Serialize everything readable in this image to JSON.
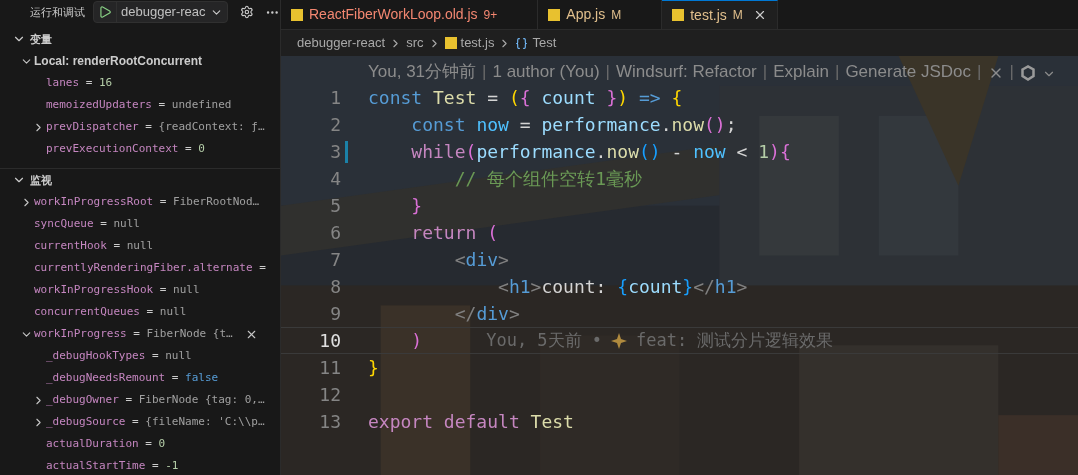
{
  "sidebar": {
    "title": "运行和调试",
    "config": "debugger-reac",
    "sections": [
      {
        "title": "变量",
        "expanded": true,
        "items": [
          {
            "name": "Local: renderRootConcurrent",
            "kind": "scope",
            "expanded": true,
            "children": [
              {
                "name": "lanes",
                "sep": "=",
                "value": "16",
                "kind": "number"
              },
              {
                "name": "memoizedUpdaters",
                "sep": "=",
                "value": "undefined",
                "kind": "plain"
              },
              {
                "name": "prevDispatcher",
                "sep": "=",
                "value": "{readContext: ƒ…",
                "kind": "plain",
                "expanded": false
              },
              {
                "name": "prevExecutionContext",
                "sep": "=",
                "value": "0",
                "kind": "number"
              }
            ]
          }
        ]
      },
      {
        "title": "监视",
        "expanded": true,
        "items": [
          {
            "name": "workInProgressRoot",
            "sep": "=",
            "value": "FiberRootNod…",
            "kind": "plain",
            "expanded": false
          },
          {
            "name": "syncQueue",
            "sep": "=",
            "value": "null",
            "kind": "plain"
          },
          {
            "name": "currentHook",
            "sep": "=",
            "value": "null",
            "kind": "plain"
          },
          {
            "name": "currentlyRenderingFiber.alternate",
            "sep": "=",
            "kind": "plain"
          },
          {
            "name": "workInProgressHook",
            "sep": "=",
            "value": "null",
            "kind": "plain"
          },
          {
            "name": "concurrentQueues",
            "sep": "=",
            "value": "null",
            "kind": "plain"
          },
          {
            "name": "workInProgress",
            "sep": "=",
            "value": "FiberNode {t…",
            "kind": "plain",
            "expanded": true,
            "hovered": true,
            "children": [
              {
                "name": "_debugHookTypes",
                "sep": "=",
                "value": "null",
                "kind": "plain"
              },
              {
                "name": "_debugNeedsRemount",
                "sep": "=",
                "value": "false",
                "kind": "boolean"
              },
              {
                "name": "_debugOwner",
                "sep": "=",
                "value": "FiberNode {tag: 0,…",
                "kind": "plain",
                "expanded": false
              },
              {
                "name": "_debugSource",
                "sep": "=",
                "value": "{fileName: 'C:\\\\p…",
                "kind": "plain",
                "expanded": false
              },
              {
                "name": "actualDuration",
                "sep": "=",
                "value": "0",
                "kind": "number"
              },
              {
                "name": "actualStartTime",
                "sep": "=",
                "value": "-1",
                "kind": "number"
              }
            ]
          }
        ]
      }
    ]
  },
  "tabs": [
    {
      "label": "ReactFiberWorkLoop.old.js",
      "badge": "9+",
      "kind": "error",
      "selected": false
    },
    {
      "label": "App.js",
      "badge": "M",
      "kind": "modified",
      "selected": false
    },
    {
      "label": "test.js",
      "badge": "M",
      "kind": "modified",
      "selected": true
    }
  ],
  "breadcrumb": [
    "debugger-react",
    "src",
    "test.js",
    "Test"
  ],
  "codelens": [
    {
      "kind": "link",
      "text": "You, 31分钟前"
    },
    {
      "kind": "separator",
      "text": "|"
    },
    {
      "kind": "link",
      "text": "1 author (You)"
    },
    {
      "kind": "separator",
      "text": "|"
    },
    {
      "kind": "link",
      "text": "Windsurf: Refactor"
    },
    {
      "kind": "separator",
      "text": "|"
    },
    {
      "kind": "link",
      "text": "Explain"
    },
    {
      "kind": "separator",
      "text": "|"
    },
    {
      "kind": "link",
      "text": "Generate JSDoc"
    },
    {
      "kind": "separator",
      "text": "|"
    },
    {
      "kind": "close"
    },
    {
      "kind": "separator",
      "text": "|"
    },
    {
      "kind": "logo"
    },
    {
      "kind": "menu"
    }
  ],
  "lines": [
    {
      "number": "1",
      "tokens": [
        {
          "text": "const ",
          "kind": "keyword"
        },
        {
          "text": "Test",
          "kind": "func"
        },
        {
          "text": " = ",
          "kind": "op"
        },
        {
          "text": "(",
          "kind": "b1"
        },
        {
          "text": "{",
          "kind": "b2"
        },
        {
          "text": " count ",
          "kind": "var"
        },
        {
          "text": "}",
          "kind": "b2"
        },
        {
          "text": ")",
          "kind": "b1"
        },
        {
          "text": " => ",
          "kind": "keyword"
        },
        {
          "text": "{",
          "kind": "b1"
        }
      ]
    },
    {
      "number": "2",
      "tokens": [
        {
          "text": "    const ",
          "kind": "keyword"
        },
        {
          "text": "now",
          "kind": "const"
        },
        {
          "text": " = ",
          "kind": "op"
        },
        {
          "text": "performance",
          "kind": "var"
        },
        {
          "text": ".",
          "kind": "op"
        },
        {
          "text": "now",
          "kind": "func"
        },
        {
          "text": "()",
          "kind": "b2"
        },
        {
          "text": ";",
          "kind": "op"
        }
      ]
    },
    {
      "number": "3",
      "modified": true,
      "tokens": [
        {
          "text": "    while",
          "kind": "control"
        },
        {
          "text": "(",
          "kind": "b2"
        },
        {
          "text": "performance",
          "kind": "var"
        },
        {
          "text": ".",
          "kind": "op"
        },
        {
          "text": "now",
          "kind": "func"
        },
        {
          "text": "()",
          "kind": "b3"
        },
        {
          "text": " - ",
          "kind": "op"
        },
        {
          "text": "now",
          "kind": "const"
        },
        {
          "text": " < ",
          "kind": "op"
        },
        {
          "text": "1",
          "kind": "number"
        },
        {
          "text": ")",
          "kind": "b2"
        },
        {
          "text": "{",
          "kind": "b2"
        }
      ]
    },
    {
      "number": "4",
      "tokens": [
        {
          "text": "        // 每个组件空转1毫秒",
          "kind": "comment"
        }
      ]
    },
    {
      "number": "5",
      "tokens": [
        {
          "text": "    }",
          "kind": "b2"
        }
      ]
    },
    {
      "number": "6",
      "tokens": [
        {
          "text": "    return ",
          "kind": "control"
        },
        {
          "text": "(",
          "kind": "b2"
        }
      ]
    },
    {
      "number": "7",
      "tokens": [
        {
          "text": "        <",
          "kind": "punct"
        },
        {
          "text": "div",
          "kind": "tag"
        },
        {
          "text": ">",
          "kind": "punct"
        }
      ]
    },
    {
      "number": "8",
      "tokens": [
        {
          "text": "            <",
          "kind": "punct"
        },
        {
          "text": "h1",
          "kind": "tag"
        },
        {
          "text": ">",
          "kind": "punct"
        },
        {
          "text": "count: ",
          "kind": "text"
        },
        {
          "text": "{",
          "kind": "b3"
        },
        {
          "text": "count",
          "kind": "var"
        },
        {
          "text": "}",
          "kind": "b3"
        },
        {
          "text": "</",
          "kind": "punct"
        },
        {
          "text": "h1",
          "kind": "tag"
        },
        {
          "text": ">",
          "kind": "punct"
        }
      ]
    },
    {
      "number": "9",
      "tokens": [
        {
          "text": "        </",
          "kind": "punct"
        },
        {
          "text": "div",
          "kind": "tag"
        },
        {
          "text": ">",
          "kind": "punct"
        }
      ]
    },
    {
      "number": "10",
      "current": true,
      "tokens": [
        {
          "text": "    )",
          "kind": "b2"
        }
      ],
      "blame": {
        "author": "You, 5天前 •",
        "message": "feat: 测试分片逻辑效果"
      }
    },
    {
      "number": "11",
      "tokens": [
        {
          "text": "}",
          "kind": "b1"
        }
      ]
    },
    {
      "number": "12"
    },
    {
      "number": "13",
      "tokens": [
        {
          "text": "export default ",
          "kind": "control"
        },
        {
          "text": "Test",
          "kind": "func"
        }
      ]
    }
  ]
}
